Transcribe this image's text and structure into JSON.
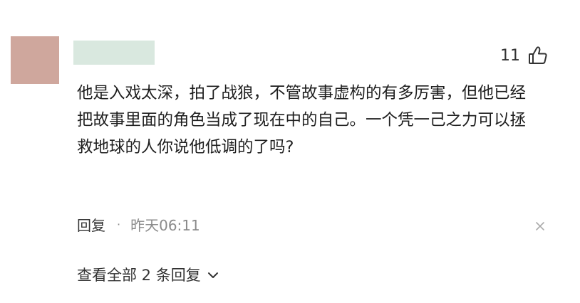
{
  "comment": {
    "likes": "11",
    "text": "他是入戏太深，拍了战狼，不管故事虚构的有多厉害，但他已经把故事里面的角色当成了现在中的自己。一个凭一己之力可以拯救地球的人你说他低调的了吗?",
    "reply_label": "回复",
    "separator": "·",
    "timestamp": "昨天06:11",
    "view_replies_label": "查看全部 2 条回复"
  },
  "icons": {
    "like": "thumbs-up-icon",
    "close": "close-icon",
    "expand": "chevron-down-icon"
  },
  "colors": {
    "avatar": "#cfa79d",
    "username_placeholder": "#d9e8df",
    "timestamp": "#8a8a8a"
  }
}
